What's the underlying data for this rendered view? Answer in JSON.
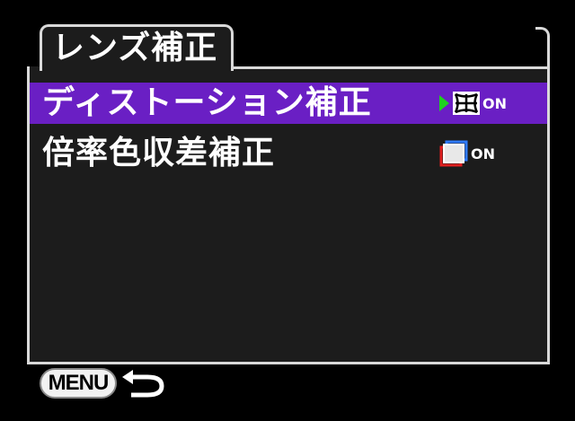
{
  "header": {
    "title": "レンズ補正"
  },
  "menu": {
    "items": [
      {
        "label": "ディストーション補正",
        "status": "ON",
        "icon": "distortion-grid-icon",
        "selected": true
      },
      {
        "label": "倍率色収差補正",
        "status": "ON",
        "icon": "chromatic-aberration-icon",
        "selected": false
      }
    ]
  },
  "footer": {
    "menu_label": "MENU",
    "back_icon": "return-arrow-icon"
  },
  "colors": {
    "highlight": "#6a1fc4",
    "frame": "#d9d9d9",
    "panel": "#1c1c1c",
    "arrow": "#1ed21e"
  }
}
